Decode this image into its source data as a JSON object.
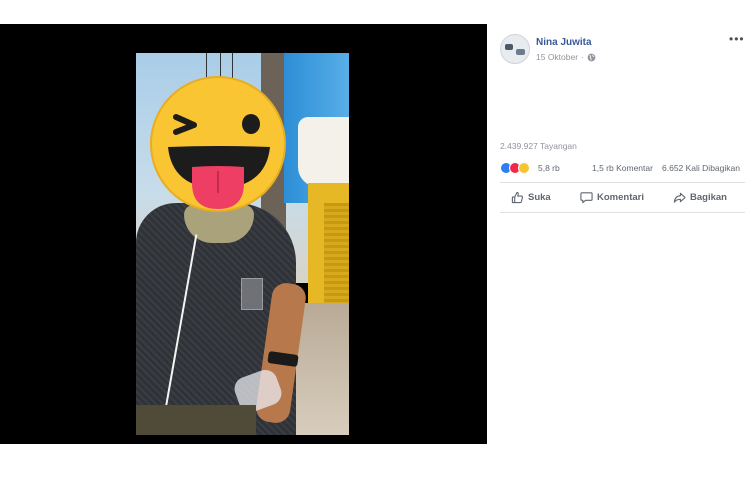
{
  "post": {
    "author": "Nina Juwita",
    "date": "15 Oktober",
    "privacy_separator": "·",
    "more_label": "•••"
  },
  "stats": {
    "views": "2.439.927 Tayangan",
    "reactions": "5,8 rb",
    "comments": "1,5 rb Komentar",
    "shares": "6.652 Kali Dibagikan"
  },
  "actions": {
    "like": "Suka",
    "comment": "Komentari",
    "share": "Bagikan"
  },
  "icons": {
    "globe": "globe-icon",
    "like": "thumbs-up-icon",
    "comment": "comment-bubble-icon",
    "share": "share-arrow-icon",
    "reaction_like": "like-reaction-icon",
    "reaction_love": "love-reaction-icon",
    "reaction_haha": "haha-reaction-icon",
    "video_overlay": "winking-tongue-emoji-icon"
  },
  "colors": {
    "brand_link": "#385898",
    "video_background": "#000000",
    "reaction_like": "#2e7df6",
    "reaction_love": "#f0284a",
    "reaction_haha": "#f7c531",
    "emoji_yellow": "#f9c532"
  }
}
